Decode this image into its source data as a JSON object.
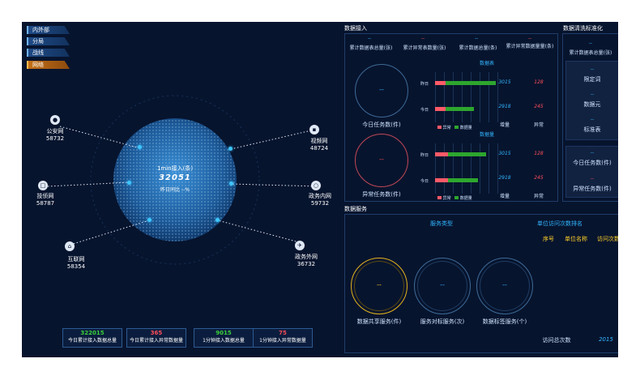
{
  "tabs": [
    {
      "label": "内外部"
    },
    {
      "label": "分局"
    },
    {
      "label": "战线"
    },
    {
      "label": "网络"
    }
  ],
  "globe": {
    "title": "1min接入(条)",
    "value": "32051",
    "compare": "昨日同比 --%"
  },
  "networks": [
    {
      "name": "公安网",
      "value": "58732"
    },
    {
      "name": "视频网",
      "value": "48724"
    },
    {
      "name": "技侦网",
      "value": "58787"
    },
    {
      "name": "政务内网",
      "value": "59732"
    },
    {
      "name": "互联网",
      "value": "58354"
    },
    {
      "name": "政务外网",
      "value": "36732"
    }
  ],
  "bottom_stats": [
    {
      "value": "322015",
      "label": "今日累计接入数据总量",
      "color": "#3bd13b"
    },
    {
      "value": "365",
      "label": "今日累计接入异常数据量",
      "color": "#ff4e5a"
    },
    {
      "value": "9015",
      "label": "1分钟接入数据总量",
      "color": "#3bd13b"
    },
    {
      "value": "75",
      "label": "1分钟接入异常数据量",
      "color": "#ff4e5a"
    }
  ],
  "access": {
    "title": "数据接入",
    "top_values": [
      "--",
      "--",
      "--",
      "--"
    ],
    "top_labels": [
      "累计数据表总量(张)",
      "累计异常表数量(张)",
      "累计数据总量(条)",
      "累计异常数据量量(条)"
    ],
    "ring1_value": "--",
    "ring1_label": "今日任务数(件)",
    "ring2_value": "--",
    "ring2_label": "异常任务数(件)",
    "table_heading": "数据表",
    "volume_heading": "数据量",
    "row_yesterday": "昨日",
    "row_today": "今日",
    "legend_normal": "异常",
    "legend_ok": "数据量",
    "table_rows": [
      {
        "inc": "3015",
        "abn": "128"
      },
      {
        "inc": "2918",
        "abn": "245"
      }
    ],
    "volume_rows": [
      {
        "inc": "3015",
        "abn": "128"
      },
      {
        "inc": "2918",
        "abn": "245"
      }
    ],
    "col_inc": "增量",
    "col_abn": "异常",
    "bars_table": [
      {
        "red": 0.15,
        "green": 0.85
      },
      {
        "red": 0.15,
        "green": 0.55
      }
    ],
    "bars_volume": [
      {
        "red": 0.18,
        "green": 0.72
      },
      {
        "red": 0.18,
        "green": 0.6
      }
    ]
  },
  "standard": {
    "title": "数据清洗标准化",
    "total_value": "--",
    "total_label": "累计数据表总量(张)",
    "items": [
      {
        "value": "--",
        "label": "限定词"
      },
      {
        "value": "--",
        "label": "数据元"
      },
      {
        "value": "--",
        "label": "标准表"
      }
    ],
    "task_value": "--",
    "task_label": "今日任务数(件)",
    "abn_value": "--",
    "abn_label": "异常任务数(件)"
  },
  "service": {
    "title": "数据服务",
    "type_heading": "服务类型",
    "rank_heading": "单位访问次数排名",
    "rank_cols": [
      "序号",
      "单位名称",
      "访问次数"
    ],
    "rings": [
      {
        "value": "--",
        "label": "数据共享服务(件)",
        "color": "#e0b21c"
      },
      {
        "value": "--",
        "label": "服务对标服务(次)",
        "color": "#3d6a96"
      },
      {
        "value": "--",
        "label": "数据标签服务(个)",
        "color": "#3d6a96"
      }
    ],
    "total_label": "访问总次数",
    "total_value": "2015"
  }
}
